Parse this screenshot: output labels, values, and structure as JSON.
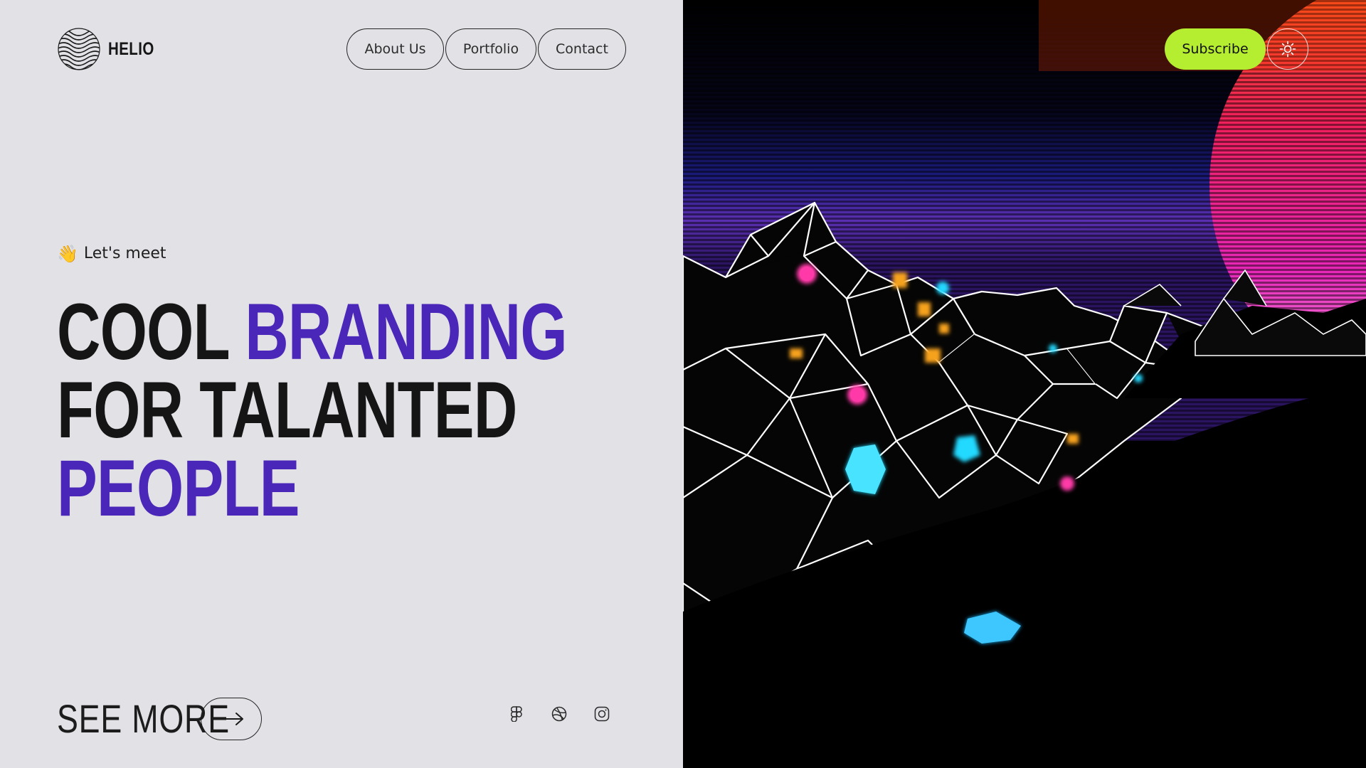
{
  "brand": {
    "name": "HELIO",
    "icon": "wavy-globe-logo"
  },
  "nav": {
    "items": [
      {
        "label": "About Us"
      },
      {
        "label": "Portfolio"
      },
      {
        "label": "Contact"
      }
    ]
  },
  "actions": {
    "subscribe_label": "Subscribe",
    "theme_icon": "sun-icon"
  },
  "hero": {
    "kicker_emoji": "👋",
    "kicker_text": "Let's meet",
    "headline": {
      "word1": "COOL ",
      "word2": "BRANDING",
      "line2": "FOR TALANTED",
      "line3": "PEOPLE"
    }
  },
  "cta": {
    "label": "SEE MORE",
    "arrow_icon": "arrow-right-icon"
  },
  "socials": [
    {
      "icon": "figma-icon"
    },
    {
      "icon": "dribbble-icon"
    },
    {
      "icon": "instagram-icon"
    }
  ],
  "colors": {
    "background": "#e2e1e6",
    "accent": "#4a27b8",
    "subscribe": "#b5ed31",
    "text": "#151515"
  }
}
